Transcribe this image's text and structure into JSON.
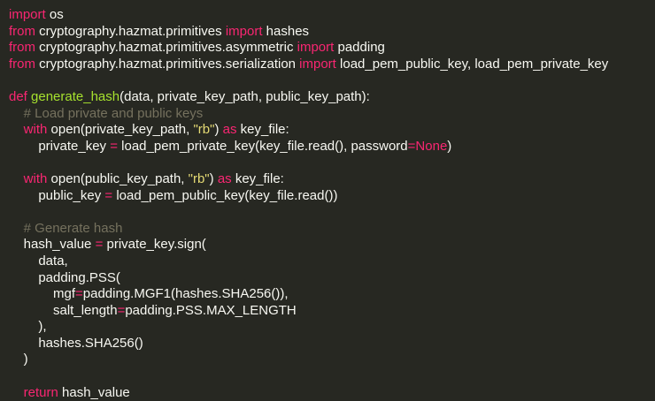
{
  "colors": {
    "background": "#272822",
    "text": "#f8f8f2",
    "keyword": "#f92672",
    "function_name": "#a6e22e",
    "string": "#e6db74",
    "comment": "#75715e"
  },
  "code": {
    "lines": [
      [
        {
          "t": "kw",
          "v": "import"
        },
        {
          "t": "txt",
          "v": " os"
        }
      ],
      [
        {
          "t": "kw",
          "v": "from"
        },
        {
          "t": "txt",
          "v": " cryptography.hazmat.primitives "
        },
        {
          "t": "kw",
          "v": "import"
        },
        {
          "t": "txt",
          "v": " hashes"
        }
      ],
      [
        {
          "t": "kw",
          "v": "from"
        },
        {
          "t": "txt",
          "v": " cryptography.hazmat.primitives.asymmetric "
        },
        {
          "t": "kw",
          "v": "import"
        },
        {
          "t": "txt",
          "v": " padding"
        }
      ],
      [
        {
          "t": "kw",
          "v": "from"
        },
        {
          "t": "txt",
          "v": " cryptography.hazmat.primitives.serialization "
        },
        {
          "t": "kw",
          "v": "import"
        },
        {
          "t": "txt",
          "v": " load_pem_public_key, load_pem_private_key"
        }
      ],
      [],
      [
        {
          "t": "kw",
          "v": "def"
        },
        {
          "t": "txt",
          "v": " "
        },
        {
          "t": "fn",
          "v": "generate_hash"
        },
        {
          "t": "txt",
          "v": "(data, private_key_path, public_key_path):"
        }
      ],
      [
        {
          "t": "txt",
          "v": "    "
        },
        {
          "t": "cm",
          "v": "# Load private and public keys"
        }
      ],
      [
        {
          "t": "txt",
          "v": "    "
        },
        {
          "t": "kw",
          "v": "with"
        },
        {
          "t": "txt",
          "v": " open(private_key_path, "
        },
        {
          "t": "str",
          "v": "\"rb\""
        },
        {
          "t": "txt",
          "v": ") "
        },
        {
          "t": "kw",
          "v": "as"
        },
        {
          "t": "txt",
          "v": " key_file:"
        }
      ],
      [
        {
          "t": "txt",
          "v": "        private_key "
        },
        {
          "t": "kw",
          "v": "="
        },
        {
          "t": "txt",
          "v": " load_pem_private_key(key_file.read(), password"
        },
        {
          "t": "kw",
          "v": "="
        },
        {
          "t": "kw",
          "v": "None"
        },
        {
          "t": "txt",
          "v": ")"
        }
      ],
      [],
      [
        {
          "t": "txt",
          "v": "    "
        },
        {
          "t": "kw",
          "v": "with"
        },
        {
          "t": "txt",
          "v": " open(public_key_path, "
        },
        {
          "t": "str",
          "v": "\"rb\""
        },
        {
          "t": "txt",
          "v": ") "
        },
        {
          "t": "kw",
          "v": "as"
        },
        {
          "t": "txt",
          "v": " key_file:"
        }
      ],
      [
        {
          "t": "txt",
          "v": "        public_key "
        },
        {
          "t": "kw",
          "v": "="
        },
        {
          "t": "txt",
          "v": " load_pem_public_key(key_file.read())"
        }
      ],
      [],
      [
        {
          "t": "txt",
          "v": "    "
        },
        {
          "t": "cm",
          "v": "# Generate hash"
        }
      ],
      [
        {
          "t": "txt",
          "v": "    hash_value "
        },
        {
          "t": "kw",
          "v": "="
        },
        {
          "t": "txt",
          "v": " private_key.sign("
        }
      ],
      [
        {
          "t": "txt",
          "v": "        data,"
        }
      ],
      [
        {
          "t": "txt",
          "v": "        padding.PSS("
        }
      ],
      [
        {
          "t": "txt",
          "v": "            mgf"
        },
        {
          "t": "kw",
          "v": "="
        },
        {
          "t": "txt",
          "v": "padding.MGF1(hashes.SHA256()),"
        }
      ],
      [
        {
          "t": "txt",
          "v": "            salt_length"
        },
        {
          "t": "kw",
          "v": "="
        },
        {
          "t": "txt",
          "v": "padding.PSS.MAX_LENGTH"
        }
      ],
      [
        {
          "t": "txt",
          "v": "        ),"
        }
      ],
      [
        {
          "t": "txt",
          "v": "        hashes.SHA256()"
        }
      ],
      [
        {
          "t": "txt",
          "v": "    )"
        }
      ],
      [],
      [
        {
          "t": "txt",
          "v": "    "
        },
        {
          "t": "kw",
          "v": "return"
        },
        {
          "t": "txt",
          "v": " hash_value"
        }
      ]
    ]
  }
}
